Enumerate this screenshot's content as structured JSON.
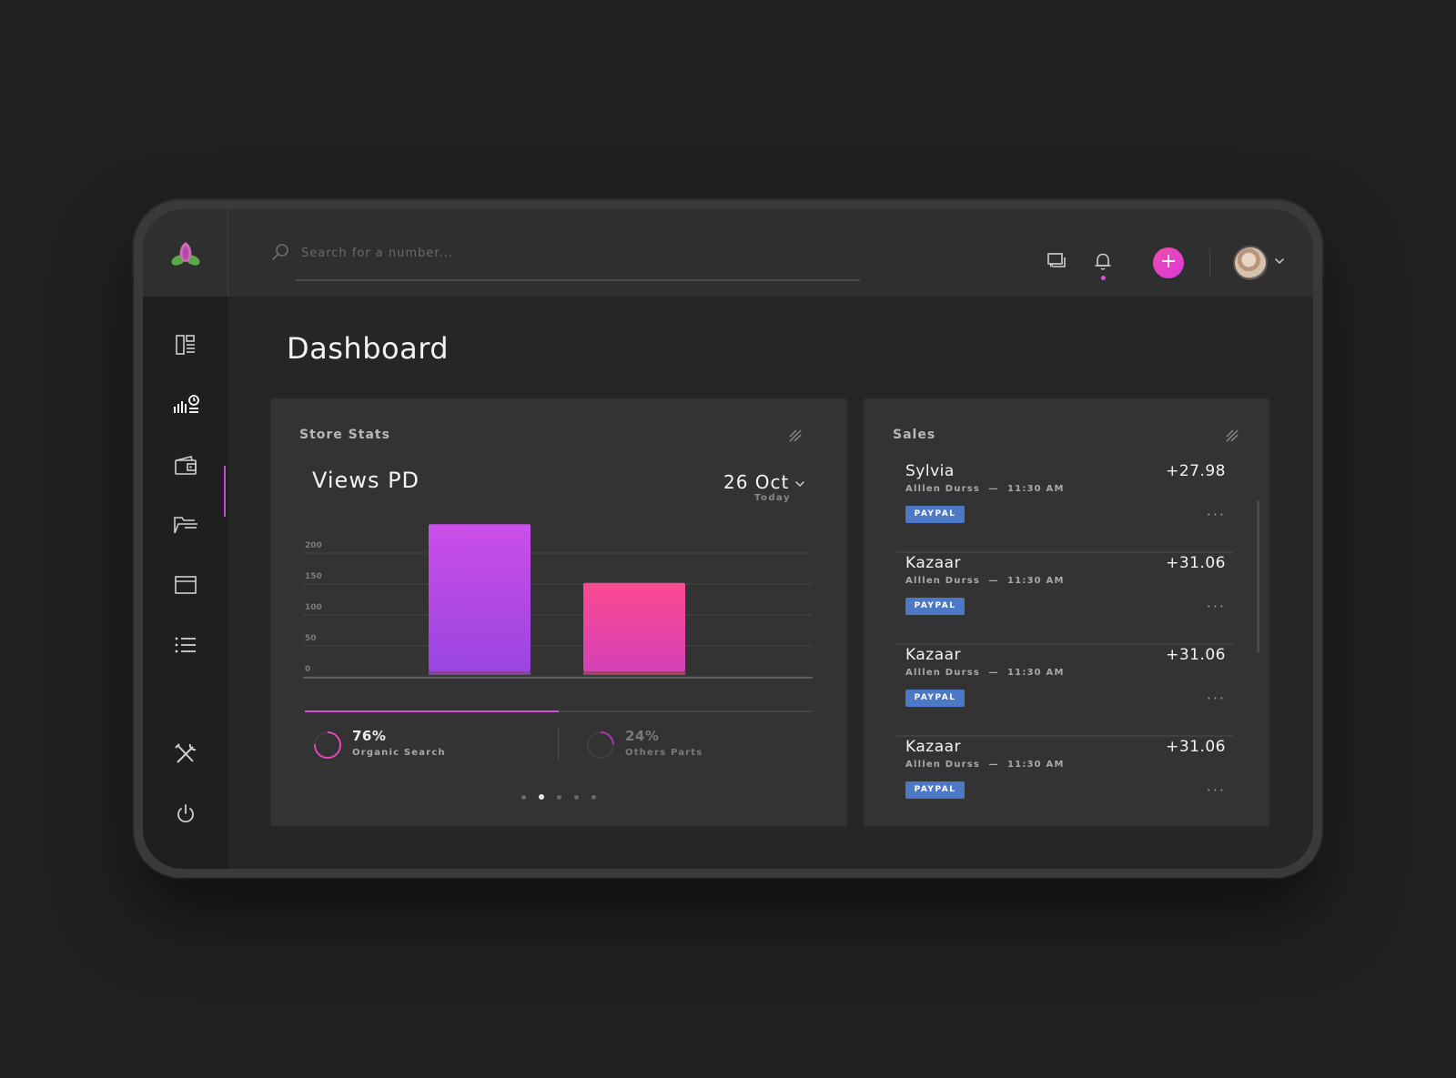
{
  "search": {
    "placeholder": "Search for a number..."
  },
  "header": {
    "add_label": "+"
  },
  "page": {
    "title": "Dashboard"
  },
  "store_stats": {
    "title": "Store Stats",
    "views_title": "Views PD",
    "date": "26 Oct",
    "date_sub": "Today",
    "progress_percent": 50,
    "stats": [
      {
        "pct": "76%",
        "label": "Organic Search",
        "value": 0.76
      },
      {
        "pct": "24%",
        "label": "Others Parts",
        "value": 0.24
      }
    ],
    "pager": {
      "count": 5,
      "active": 1
    }
  },
  "chart_data": {
    "type": "bar",
    "categories": [
      "",
      ""
    ],
    "values": [
      235,
      140
    ],
    "y_ticks": [
      "200",
      "150",
      "100",
      "50",
      "0"
    ],
    "ylim": [
      0,
      200
    ],
    "colors": [
      "#c34be8",
      "#f04a90"
    ],
    "grid": true
  },
  "sales": {
    "title": "Sales",
    "items": [
      {
        "name": "Sylvia",
        "amount": "+27.98",
        "who": "Alllen Durss",
        "time": "11:30 AM",
        "badge": "PAYPAL"
      },
      {
        "name": "Kazaar",
        "amount": "+31.06",
        "who": "Alllen Durss",
        "time": "11:30 AM",
        "badge": "PAYPAL"
      },
      {
        "name": "Kazaar",
        "amount": "+31.06",
        "who": "Alllen Durss",
        "time": "11:30 AM",
        "badge": "PAYPAL"
      },
      {
        "name": "Kazaar",
        "amount": "+31.06",
        "who": "Alllen Durss",
        "time": "11:30 AM",
        "badge": "PAYPAL"
      }
    ]
  },
  "colors": {
    "accent": "#d24fd8",
    "badge": "#4c78c6",
    "add_button": "#e446c4"
  },
  "icons": {
    "sidebar": [
      "dashboard-icon",
      "analytics-icon",
      "wallet-icon",
      "folder-icon",
      "window-icon",
      "list-icon",
      "tools-icon",
      "power-icon"
    ],
    "topbar": [
      "search-icon",
      "chat-icon",
      "bell-icon",
      "plus-icon",
      "chevron-down-icon"
    ]
  }
}
